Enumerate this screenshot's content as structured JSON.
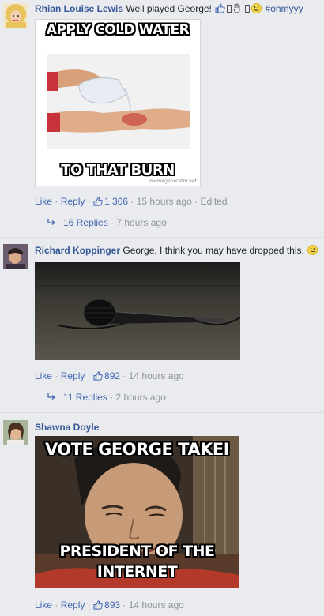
{
  "comments": [
    {
      "author": "Rhian Louise Lewis",
      "text": "Well played George!",
      "hashtag": "#ohmyyy",
      "image": {
        "top_caption": "APPLY COLD WATER",
        "bottom_caption": "TO THAT BURN",
        "watermark": "memegenerator.net"
      },
      "actions": {
        "like": "Like",
        "reply": "Reply",
        "likes_count": "1,306",
        "time": "15 hours ago",
        "edited": "Edited"
      },
      "replies": {
        "label": "16 Replies",
        "time": "7 hours ago"
      }
    },
    {
      "author": "Richard Koppinger",
      "text": "George, I think you may have dropped this.",
      "actions": {
        "like": "Like",
        "reply": "Reply",
        "likes_count": "892",
        "time": "14 hours ago"
      },
      "replies": {
        "label": "11 Replies",
        "time": "2 hours ago"
      }
    },
    {
      "author": "Shawna Doyle",
      "image": {
        "top_caption": "VOTE GEORGE TAKEI",
        "bottom_caption_1": "PRESIDENT OF THE",
        "bottom_caption_2": "INTERNET"
      },
      "actions": {
        "like": "Like",
        "reply": "Reply",
        "likes_count": "893",
        "time": "14 hours ago"
      }
    }
  ],
  "colors": {
    "link": "#4267b2",
    "author": "#365899",
    "meta": "#90949c",
    "background": "#e9ebee"
  },
  "icons": [
    "thumbs-up-icon",
    "reply-arrow-icon",
    "smiley-icon"
  ]
}
